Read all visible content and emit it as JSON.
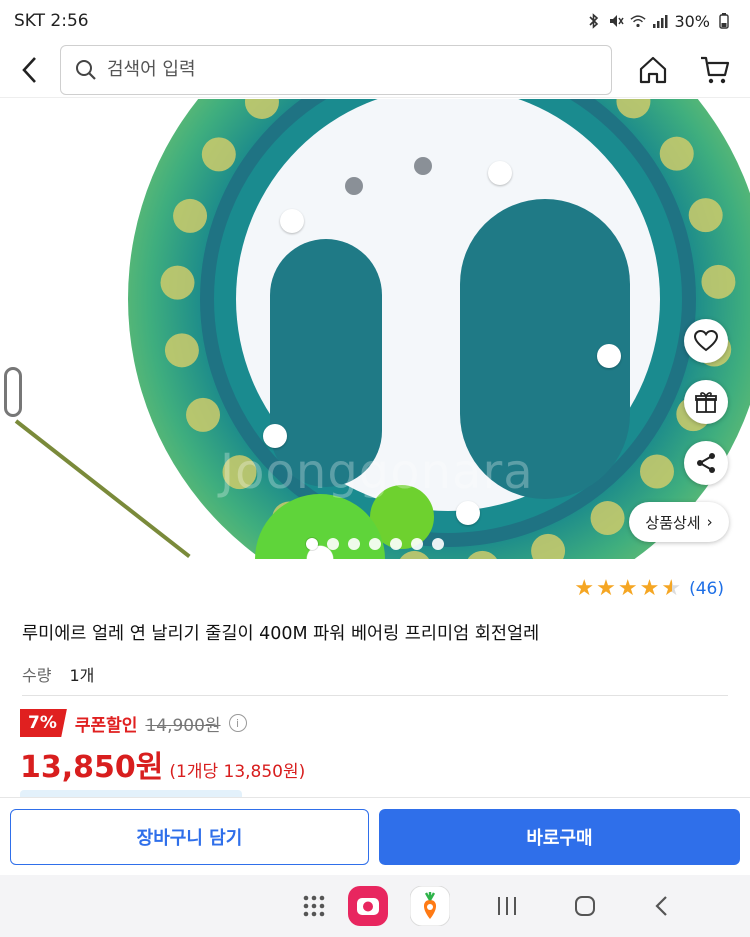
{
  "status_bar": {
    "carrier_time": "SKT 2:56",
    "battery": "30%",
    "icons": [
      "bluetooth-icon",
      "mute-icon",
      "wifi-icon",
      "signal-icon"
    ]
  },
  "header": {
    "search_placeholder": "검색어 입력",
    "icons": [
      "back-icon",
      "search-icon",
      "home-icon",
      "cart-icon"
    ]
  },
  "hero": {
    "watermark": "Joonggonara",
    "detail_button_label": "상품상세",
    "detail_button_arrow": "›",
    "float_icons": [
      "heart-icon",
      "gift-icon",
      "share-icon"
    ],
    "page_count": 7,
    "active_page": 1
  },
  "product": {
    "rating": 4.5,
    "review_count": "(46)",
    "title": "루미에르 얼레 연 날리기 줄길이 400M 파워 베어링 프리미엄 회전얼레",
    "quantity_label": "수량",
    "quantity_value": "1개",
    "discount_percent": "7%",
    "coupon_label": "쿠폰할인",
    "original_price": "14,900원",
    "price": "13,850원",
    "unit_price": "(1개당 13,850원)"
  },
  "actions": {
    "cart_label": "장바구니 담기",
    "buy_label": "바로구매"
  },
  "navbar": {
    "icons": [
      "apps-grid-icon",
      "camera-app-icon",
      "carrot-app-icon",
      "recents-icon",
      "home-circle-icon",
      "back-nav-icon"
    ]
  },
  "colors": {
    "accent_blue": "#2f6fea",
    "price_red": "#d81e1e",
    "star_orange": "#f5a623"
  }
}
